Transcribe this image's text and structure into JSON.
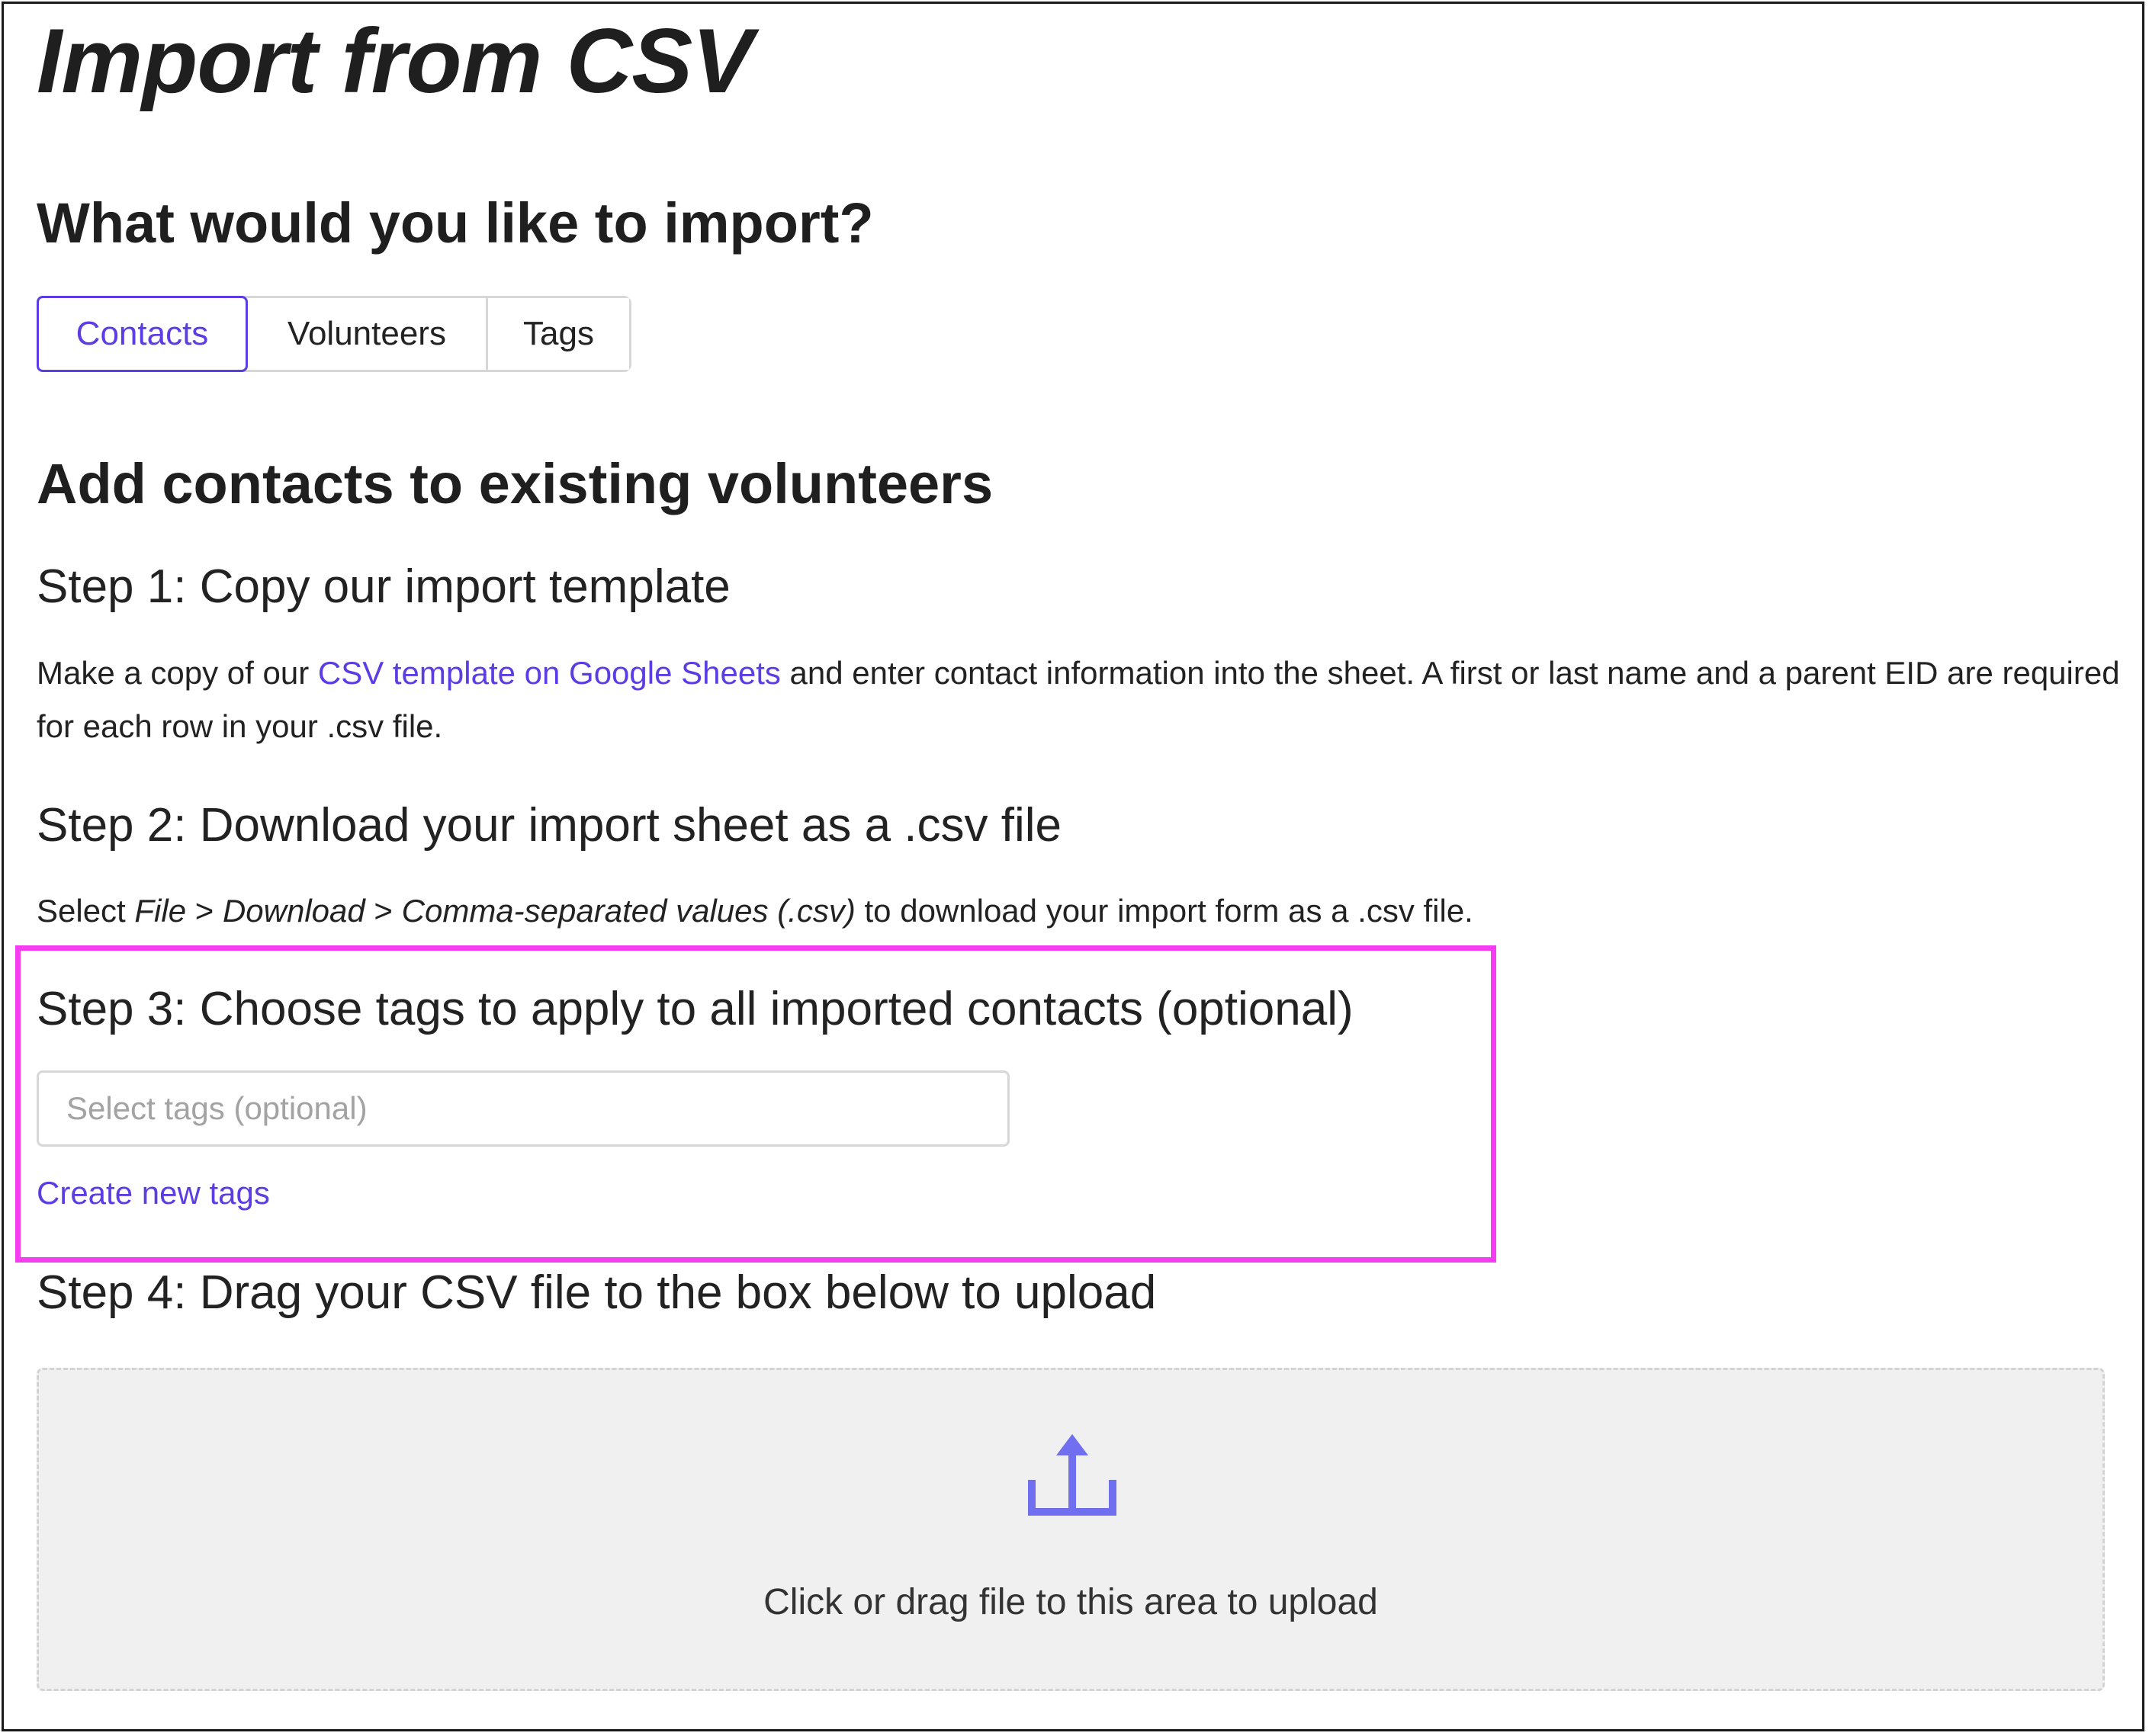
{
  "title": "Import from CSV",
  "import_question": "What would you like to import?",
  "tabs": [
    {
      "label": "Contacts",
      "active": true
    },
    {
      "label": "Volunteers",
      "active": false
    },
    {
      "label": "Tags",
      "active": false
    }
  ],
  "subheading": "Add contacts to existing volunteers",
  "steps": {
    "step1": {
      "title": "Step 1: Copy our import template",
      "text_before": "Make a copy of our ",
      "link": "CSV template on Google Sheets",
      "text_after": " and enter contact information into the sheet. A first or last name and a parent EID are required for each row in your .csv file."
    },
    "step2": {
      "title": "Step 2: Download your import sheet as a .csv file",
      "text_select": "Select ",
      "menu_file": "File",
      "sep1": " > ",
      "menu_download": "Download",
      "sep2": " > ",
      "menu_csv": "Comma-separated values (.csv)",
      "text_after": " to download your import form as a .csv file."
    },
    "step3": {
      "title": "Step 3: Choose tags to apply to all imported contacts (optional)",
      "select_placeholder": "Select tags (optional)",
      "create_link": "Create new tags"
    },
    "step4": {
      "title": "Step 4: Drag your CSV file to the box below to upload",
      "upload_text": "Click or drag file to this area to upload"
    }
  },
  "colors": {
    "accent": "#5b3de3",
    "highlight": "#f43df0",
    "upload_icon": "#6f6ff0",
    "dropzone_bg": "#f0f0f0"
  },
  "icons": {
    "upload": "upload-icon"
  }
}
